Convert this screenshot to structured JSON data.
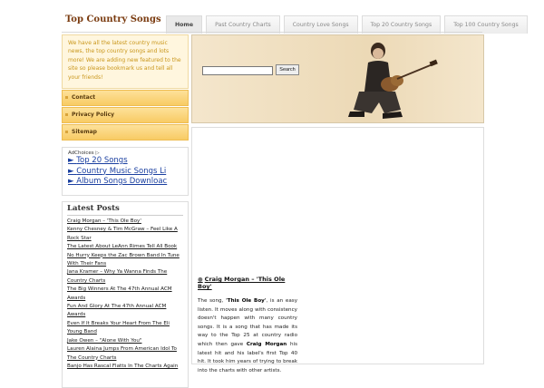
{
  "site": {
    "title": "Top Country Songs"
  },
  "nav": {
    "tabs": [
      "Home",
      "Past Country Charts",
      "Country Love Songs",
      "Top 20 Country Songs",
      "Top 100 Country Songs"
    ],
    "active": 0
  },
  "sidebar": {
    "intro": "We have all the latest country music news, the top country songs and lots more! We are adding new featured to the site so please bookmark us and tell all your friends!",
    "menu": [
      "Contact",
      "Privacy Policy",
      "Sitemap"
    ],
    "ads": {
      "adchoices": "AdChoices",
      "links": [
        "Top 20 Songs",
        "Country Music Songs Li",
        "Album Songs Downloac"
      ]
    },
    "latest": {
      "heading": "Latest Posts",
      "posts": [
        "Craig Morgan – 'This Ole Boy'",
        "Kenny Chesney & Tim McGraw – Feel Like A Rock Star",
        "The Latest About LeAnn Rimes Tell All Book",
        "No Hurry Keeps the Zac Brown Band In Tune With Their Fans",
        "Jana Kramer – Why Ya Wanna Finds The Country Charts",
        "The Big Winners At The 47th Annual ACM Awards",
        "Fun And Glory At The 47th Annual ACM Awards",
        "Even If It Breaks Your Heart From The Eli Young Band",
        "Jake Owen – \"Alone With You\"",
        "Lauren Alaina Jumps From American Idol To The Country Charts",
        "Banjo Has Rascal Flatts In The Charts Again"
      ]
    }
  },
  "search": {
    "button_label": "Search",
    "value": ""
  },
  "article": {
    "title": "Craig Morgan – 'This Ole Boy'",
    "body_intro": "The song, ",
    "body_song": "'This Ole Boy'",
    "body_mid": ", is an easy listen. It moves along with consistency doesn't happen with many country songs. It is a song that has made its way to the Top 25 at country radio which then gave ",
    "body_artist": "Craig Morgan",
    "body_end": " his latest hit and his label's first Top 40 hit. It took him years of trying to break into the charts with other artists."
  },
  "colors": {
    "title": "#7a3b10",
    "menu": "#f8cb64",
    "intro_text": "#c9961a",
    "ad_link": "#1a3fa0"
  }
}
